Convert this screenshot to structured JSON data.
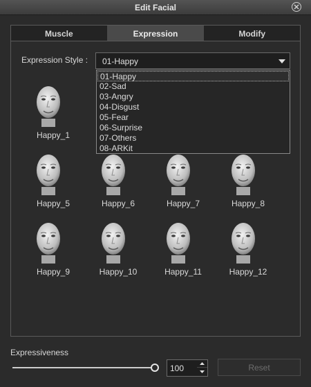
{
  "window": {
    "title": "Edit Facial"
  },
  "tabs": [
    {
      "label": "Muscle",
      "active": false
    },
    {
      "label": "Expression",
      "active": true
    },
    {
      "label": "Modify",
      "active": false
    }
  ],
  "expression_style": {
    "label": "Expression Style :",
    "selected": "01-Happy",
    "options": [
      "01-Happy",
      "02-Sad",
      "03-Angry",
      "04-Disgust",
      "05-Fear",
      "06-Surprise",
      "07-Others",
      "08-ARKit"
    ]
  },
  "faces": [
    {
      "label": "Happy_1"
    },
    {
      "label": "Happy_5"
    },
    {
      "label": "Happy_6"
    },
    {
      "label": "Happy_7"
    },
    {
      "label": "Happy_8"
    },
    {
      "label": "Happy_9"
    },
    {
      "label": "Happy_10"
    },
    {
      "label": "Happy_11"
    },
    {
      "label": "Happy_12"
    }
  ],
  "expressiveness": {
    "label": "Expressiveness",
    "value": "100",
    "slider_fraction": 1.0
  },
  "reset_label": "Reset"
}
